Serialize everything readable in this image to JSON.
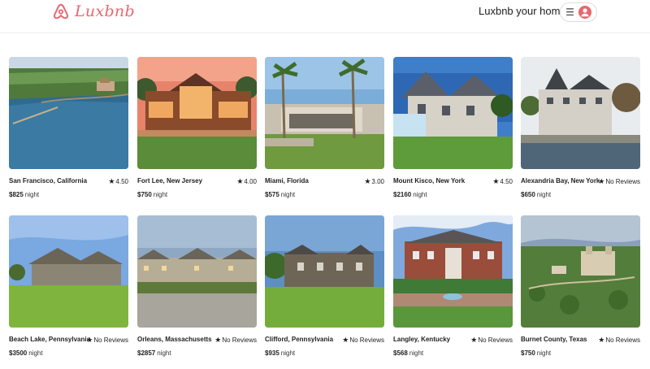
{
  "header": {
    "brand": "Luxbnb",
    "host_link": "Luxbnb your home",
    "menu_icon": "hamburger-icon",
    "user_icon": "user-circle-icon",
    "brand_color": "#e8676f"
  },
  "listings": [
    {
      "location": "San Francisco, California",
      "rating": "4.50",
      "price": "$825",
      "unit": "night",
      "scene": "bay"
    },
    {
      "location": "Fort Lee, New Jersey",
      "rating": "4.00",
      "price": "$750",
      "unit": "night",
      "scene": "lodge"
    },
    {
      "location": "Miami, Florida",
      "rating": "3.00",
      "price": "$575",
      "unit": "night",
      "scene": "palms"
    },
    {
      "location": "Mount Kisco, New York",
      "rating": "4.50",
      "price": "$2160",
      "unit": "night",
      "scene": "tudor"
    },
    {
      "location": "Alexandria Bay, New York",
      "rating": "No Reviews",
      "price": "$650",
      "unit": "night",
      "scene": "victorian"
    },
    {
      "location": "Beach Lake, Pennsylvania",
      "rating": "No Reviews",
      "price": "$3500",
      "unit": "night",
      "scene": "cottage"
    },
    {
      "location": "Orleans, Massachusetts",
      "rating": "No Reviews",
      "price": "$2857",
      "unit": "night",
      "scene": "estate"
    },
    {
      "location": "Clifford, Pennsylvania",
      "rating": "No Reviews",
      "price": "$935",
      "unit": "night",
      "scene": "stone"
    },
    {
      "location": "Langley, Kentucky",
      "rating": "No Reviews",
      "price": "$568",
      "unit": "night",
      "scene": "mansion"
    },
    {
      "location": "Burnet County, Texas",
      "rating": "No Reviews",
      "price": "$750",
      "unit": "night",
      "scene": "castle"
    }
  ]
}
